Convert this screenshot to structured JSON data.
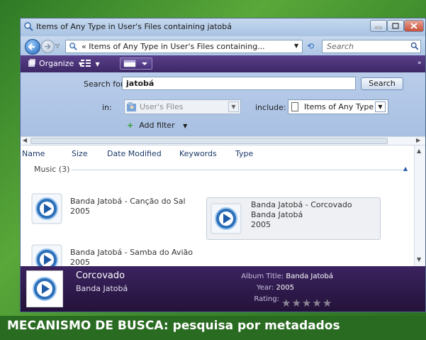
{
  "window": {
    "title": "Items of Any Type in User's Files containing jatobá"
  },
  "address_bar": {
    "path_text": "« Items of Any Type in User's Files containing...",
    "search_placeholder": "Search"
  },
  "toolbar": {
    "organize_label": "Organize",
    "organize_arrow": "▼",
    "views_arrow": "▼"
  },
  "search_pane": {
    "search_for_label": "Search for:",
    "query": "jatobá",
    "search_button": "Search",
    "in_label": "in:",
    "in_value": "User's Files",
    "include_label": "include:",
    "include_value": "Items of Any Type",
    "add_filter_label": "Add filter",
    "add_filter_arrow": "▼"
  },
  "columns": [
    "Name",
    "Size",
    "Date Modified",
    "Keywords",
    "Type"
  ],
  "group": {
    "label": "Music (3)"
  },
  "items": [
    {
      "title": "Banda Jatobá - Canção do Sal",
      "line2": "2005",
      "line3": "",
      "selected": false
    },
    {
      "title": "Banda Jatobá - Corcovado",
      "line2": "Banda Jatobá",
      "line3": "2005",
      "selected": true
    },
    {
      "title": "Banda Jatobá - Samba do Avião",
      "line2": "2005",
      "line3": "",
      "selected": false
    }
  ],
  "details": {
    "title": "Corcovado",
    "subtitle": "Banda Jatobá",
    "album_title_key": "Album Title:",
    "album_title_value": "Banda Jatobá",
    "year_key": "Year:",
    "year_value": "2005",
    "rating_key": "Rating:",
    "rating_stars": 0,
    "rating_max": 5
  },
  "caption": {
    "highlight": "MECANISMO DE BUSCA:",
    "text": "pesquisa por metadados"
  },
  "colors": {
    "frame_green": "#3c8a2c",
    "toolbar_purple": "#4a3276",
    "details_purple": "#2e1a4c",
    "search_pane_blue": "#b1c7e7"
  }
}
